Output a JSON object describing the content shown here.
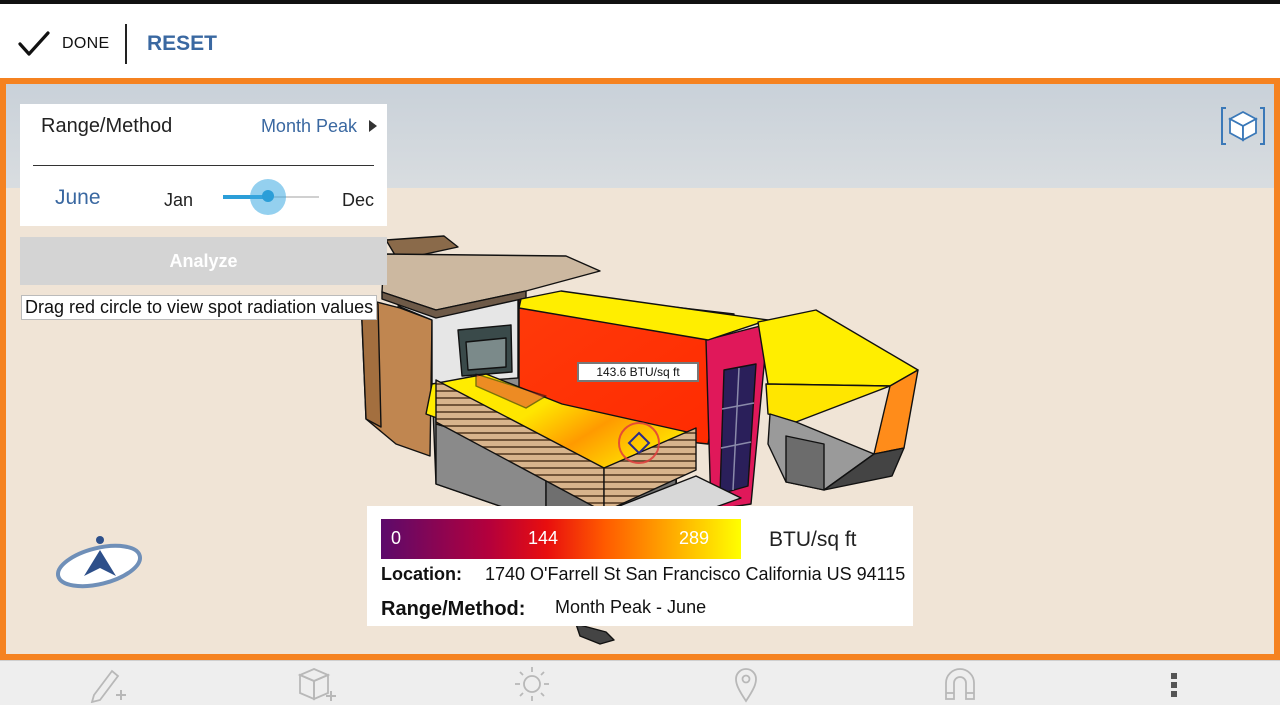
{
  "toolbar": {
    "done_label": "DONE",
    "reset_label": "RESET"
  },
  "panel": {
    "range_label": "Range/Method",
    "range_value": "Month Peak",
    "month_value": "June",
    "slider_min": "Jan",
    "slider_max": "Dec",
    "slider_level": 0.47
  },
  "analyze_label": "Analyze",
  "hint": "Drag red circle to view spot radiation values",
  "spot_value": "143.6 BTU/sq ft",
  "legend": {
    "ticks": [
      "0",
      "144",
      "289"
    ],
    "unit": "BTU/sq ft",
    "location_label": "Location:",
    "location_value": "1740 O'Farrell St San Francisco California US 94115",
    "method_label": "Range/Method:",
    "method_value": "Month Peak - June"
  },
  "colors": {
    "accent_orange": "#f58220",
    "link_blue": "#3a68a1",
    "slider_blue": "#2b9ed8"
  },
  "icons": {
    "done": "checkmark-icon",
    "expand": "chevron-right-icon",
    "view": "view-cube-icon",
    "compass": "compass-icon",
    "tools": [
      "pencil-add-icon",
      "cube-add-icon",
      "sun-icon",
      "location-pin-icon",
      "magnet-icon",
      "more-vertical-icon"
    ]
  }
}
